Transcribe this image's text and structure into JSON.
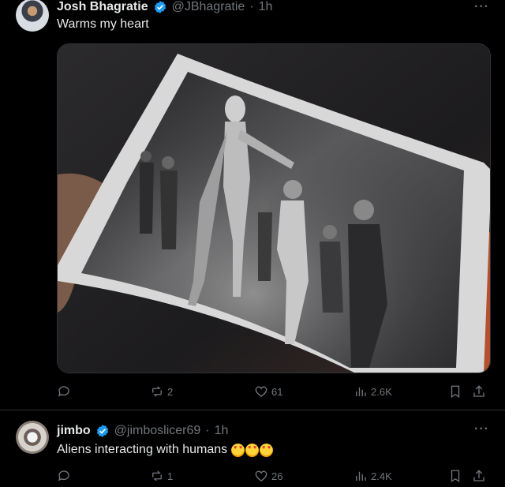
{
  "tweets": [
    {
      "name": "Josh Bhagratie",
      "handle": "@JBhagratie",
      "dot": "·",
      "time": "1h",
      "text": "Warms my heart",
      "more": "···",
      "stats": {
        "reply": "",
        "retweets": "2",
        "likes": "61",
        "views": "2.6K"
      },
      "media_alt": "photo of a book page showing a tall alien figure reaching toward a group of men"
    },
    {
      "name": "jimbo",
      "handle": "@jimboslicer69",
      "dot": "·",
      "time": "1h",
      "text": "Aliens interacting with humans",
      "emoji": [
        "heart-eyes-emoji",
        "heart-eyes-emoji",
        "heart-eyes-emoji"
      ],
      "more": "···",
      "stats": {
        "reply": "",
        "retweets": "1",
        "likes": "26",
        "views": "2.4K"
      }
    }
  ],
  "colors": {
    "background": "#000000",
    "text": "#e7e9ea",
    "muted": "#71767b",
    "verified": "#1d9bf0",
    "divider": "#2f3336"
  }
}
